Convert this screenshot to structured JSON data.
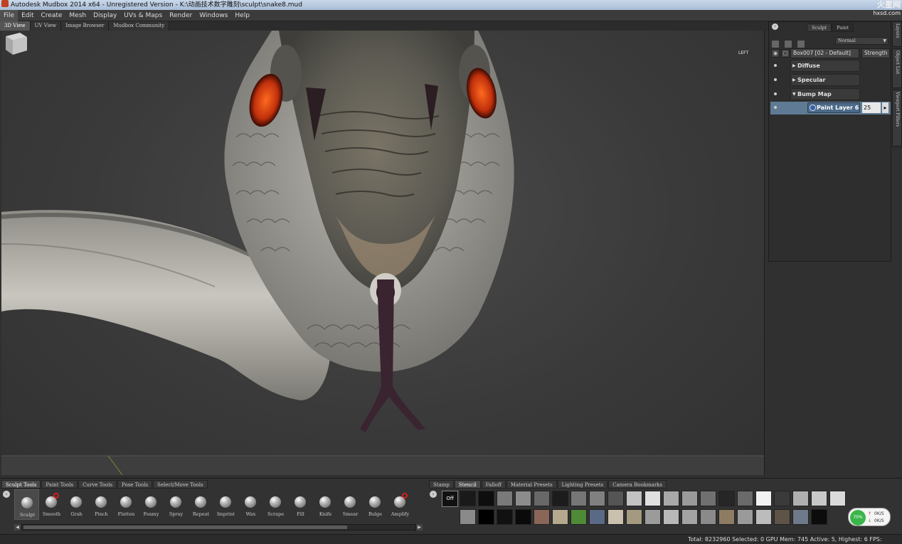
{
  "window": {
    "title": "Autodesk Mudbox 2014 x64 - Unregistered Version - K:\\动画技术数字雕刻\\sculpt\\snake8.mud",
    "watermark": "火星网",
    "watermark_sub": "hxsd.com"
  },
  "menu": [
    "File",
    "Edit",
    "Create",
    "Mesh",
    "Display",
    "UVs & Maps",
    "Render",
    "Windows",
    "Help"
  ],
  "view_tabs": [
    "3D View",
    "UV View",
    "Image Browser",
    "Mudbox Community"
  ],
  "viewport": {
    "view_cube_label": "LEFT"
  },
  "right_panel": {
    "mode_tabs": [
      "Sculpt",
      "Paint"
    ],
    "blend_mode": "Normal",
    "object_name": "Box007 [02 - Default]",
    "strength_header": "Strength",
    "groups": [
      {
        "name": "Diffuse",
        "expanded": false
      },
      {
        "name": "Specular",
        "expanded": false
      },
      {
        "name": "Bump Map",
        "expanded": true
      }
    ],
    "selected_layer": {
      "name": "Paint Layer 6",
      "strength": "25"
    }
  },
  "side_tabs": [
    "Layers",
    "Object List",
    "Viewport Filters"
  ],
  "tray": {
    "left_tabs": [
      "Sculpt Tools",
      "Paint Tools",
      "Curve Tools",
      "Pose Tools",
      "Select/Move Tools"
    ],
    "right_tabs": [
      "Stamp",
      "Stencil",
      "Falloff",
      "Material Presets",
      "Lighting Presets",
      "Camera Bookmarks"
    ],
    "tools": [
      "Sculpt",
      "Smooth",
      "Grab",
      "Pinch",
      "Flatten",
      "Foamy",
      "Spray",
      "Repeat",
      "Imprint",
      "Wax",
      "Scrape",
      "Fill",
      "Knife",
      "Smear",
      "Bulge",
      "Amplify"
    ],
    "stencil_off_label": "Off"
  },
  "gpu_widget": {
    "percent": "70%",
    "line1": "0K/S",
    "line2": "0K/S"
  },
  "status": {
    "text": "Total: 8232960  Selected: 0 GPU Mem: 745  Active: 5, Highest: 6  FPS:"
  }
}
